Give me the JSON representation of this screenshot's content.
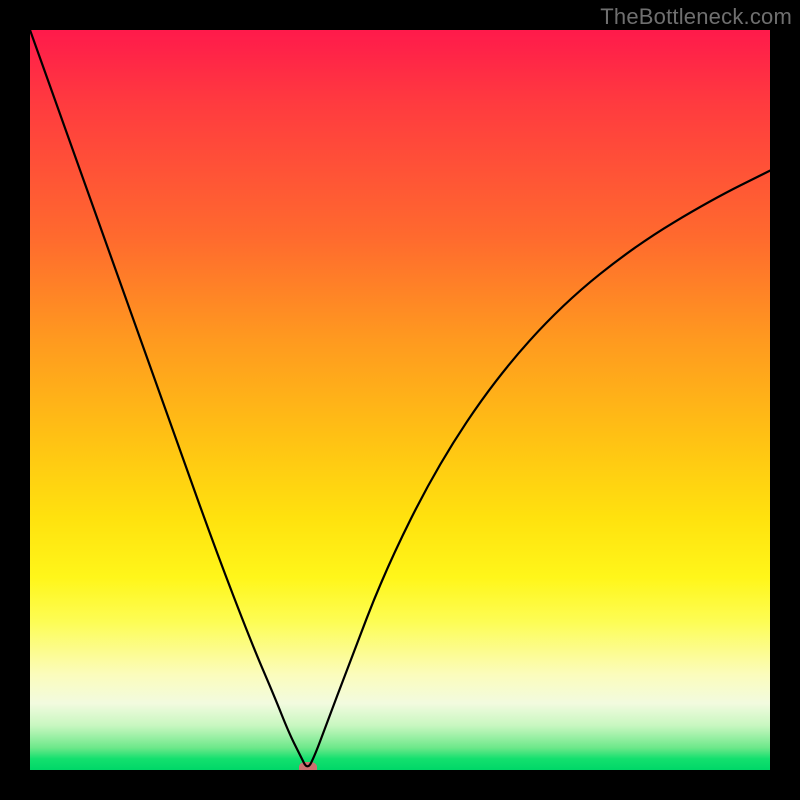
{
  "watermark": "TheBottleneck.com",
  "chart_data": {
    "type": "line",
    "title": "",
    "xlabel": "",
    "ylabel": "",
    "xlim": [
      0,
      100
    ],
    "ylim": [
      0,
      100
    ],
    "grid": false,
    "legend": false,
    "series": [
      {
        "name": "bottleneck-curve",
        "x": [
          0,
          5,
          10,
          15,
          20,
          25,
          30,
          33,
          35,
          36.5,
          37.5,
          38.5,
          40,
          43,
          48,
          55,
          63,
          72,
          82,
          92,
          100
        ],
        "y": [
          100,
          86,
          72,
          58,
          44,
          30,
          17,
          10,
          5,
          2,
          0,
          2,
          6,
          14,
          27,
          41,
          53,
          63,
          71,
          77,
          81
        ]
      }
    ],
    "annotations": [
      {
        "name": "optimal-marker",
        "x": 37.5,
        "y": 0,
        "color": "#cc6f6f"
      }
    ],
    "background_gradient": {
      "top": "#ff1a4b",
      "mid": "#ffe20e",
      "bottom": "#00d768"
    }
  }
}
